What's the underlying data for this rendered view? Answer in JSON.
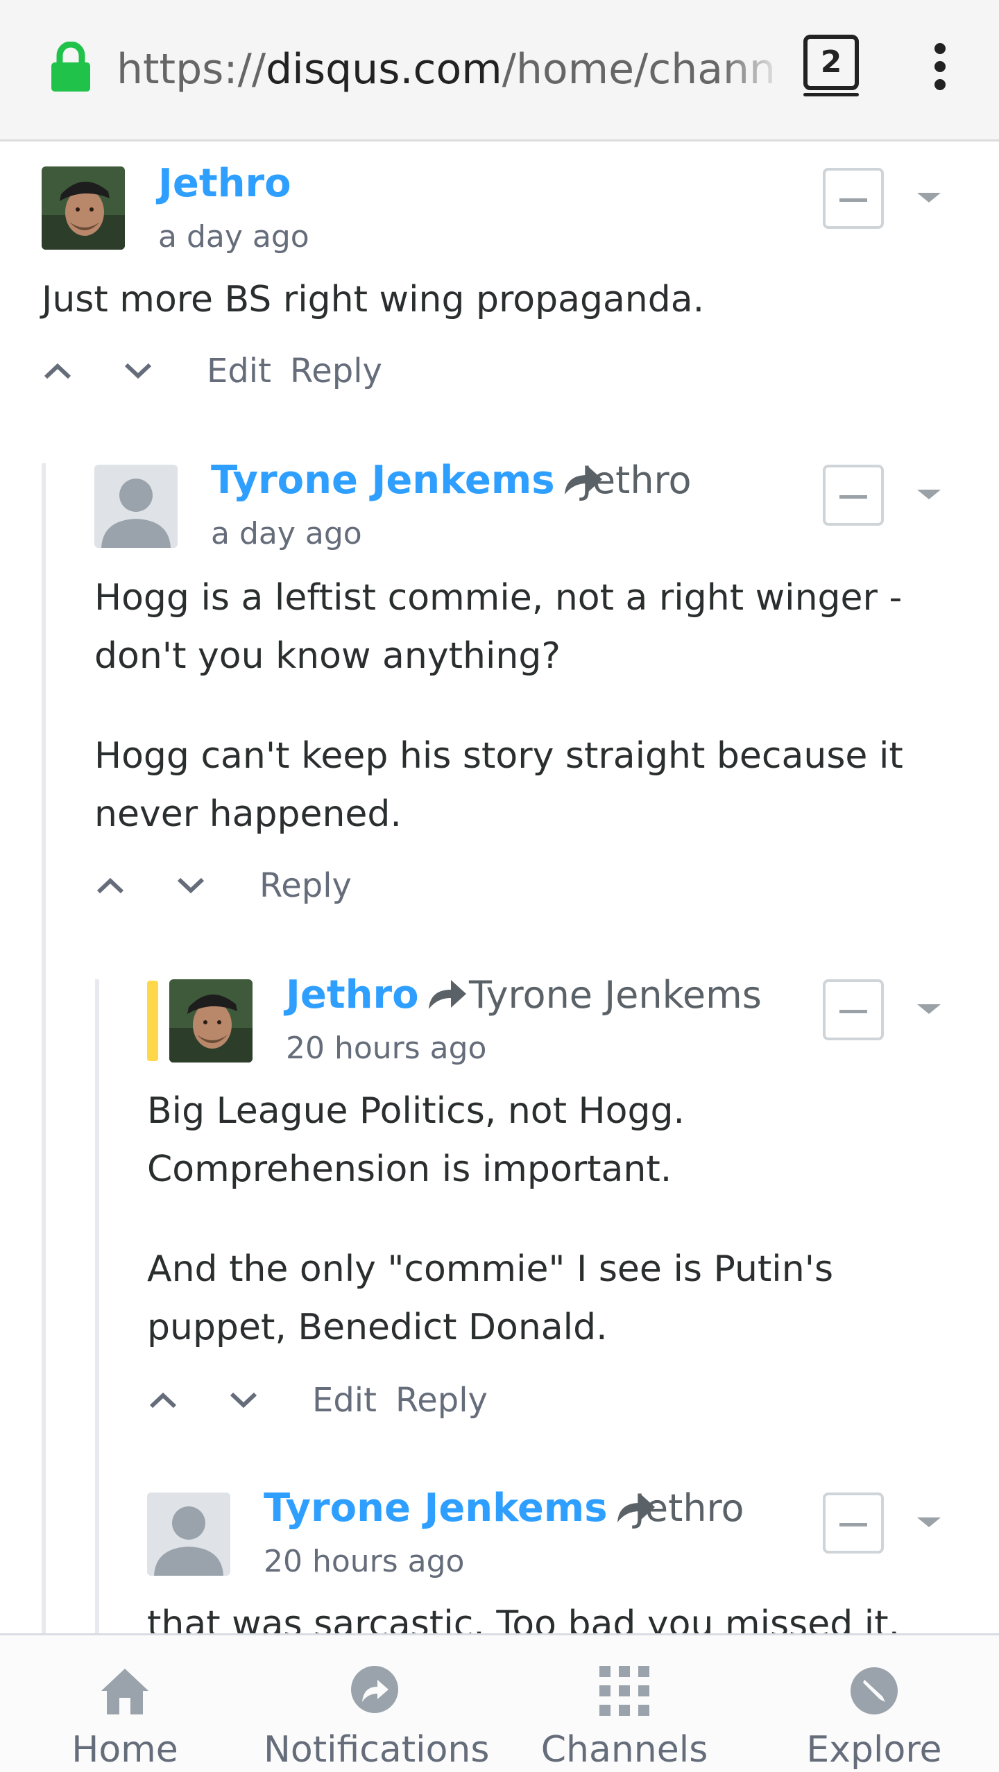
{
  "browser": {
    "url_scheme": "https://",
    "url_domain": "disqus.com",
    "url_path": "/home/channe",
    "tab_count": "2",
    "accent_color": "#21c24a"
  },
  "comments": [
    {
      "author": "Jethro",
      "reply_to": "",
      "time": "a day ago",
      "avatar": "photo",
      "paragraphs": [
        [
          "Just more BS right wing propaganda."
        ]
      ],
      "actions": [
        "Edit",
        "Reply"
      ]
    },
    {
      "author": "Tyrone Jenkems",
      "reply_to": "Jethro",
      "time": "a day ago",
      "avatar": "default",
      "paragraphs": [
        [
          "Hogg is a leftist commie, not a right winger -",
          "don't you know anything?"
        ],
        [
          "Hogg can't keep his story straight because it",
          "never happened."
        ]
      ],
      "actions": [
        "Reply"
      ]
    },
    {
      "author": "Jethro",
      "reply_to": "Tyrone Jenkems",
      "time": "20 hours ago",
      "avatar": "photo",
      "paragraphs": [
        [
          "Big League Politics, not Hogg.",
          "Comprehension is important."
        ],
        [
          "And the only \"commie\" I see is Putin's",
          "puppet, Benedict Donald."
        ]
      ],
      "actions": [
        "Edit",
        "Reply"
      ]
    },
    {
      "author": "Tyrone Jenkems",
      "reply_to": "Jethro",
      "time": "20 hours ago",
      "avatar": "default",
      "paragraphs": [
        [
          "that was sarcastic. Too bad you missed it."
        ]
      ],
      "actions": []
    }
  ],
  "bottom_nav": [
    {
      "label": "Home",
      "icon": "home-icon"
    },
    {
      "label": "Notifications",
      "icon": "notifications-icon"
    },
    {
      "label": "Channels",
      "icon": "channels-icon"
    },
    {
      "label": "Explore",
      "icon": "explore-icon"
    }
  ]
}
